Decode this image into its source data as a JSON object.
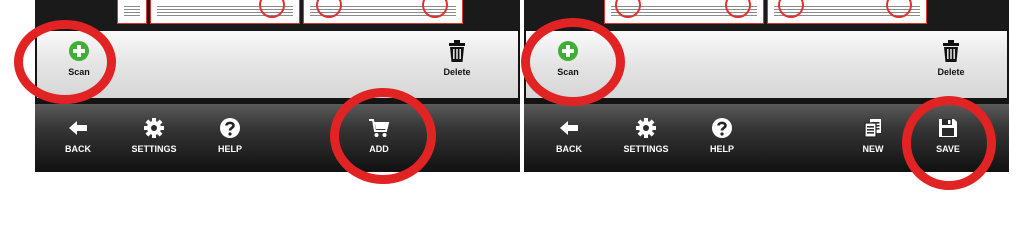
{
  "screens": [
    {
      "top_toolbar": {
        "scan_label": "Scan",
        "delete_label": "Delete"
      },
      "bottom_toolbar": {
        "back_label": "BACK",
        "settings_label": "SETTINGS",
        "help_label": "HELP",
        "add_label": "ADD"
      }
    },
    {
      "top_toolbar": {
        "scan_label": "Scan",
        "delete_label": "Delete"
      },
      "bottom_toolbar": {
        "back_label": "BACK",
        "settings_label": "SETTINGS",
        "help_label": "HELP",
        "new_label": "NEW",
        "save_label": "SAVE"
      }
    }
  ],
  "colors": {
    "highlight_ring": "#e22323",
    "scan_icon_green": "#3fae35",
    "toolbar_dark": "#222222",
    "toolbar_light": "#e6e6e6"
  },
  "icons": [
    "plus-circle-icon",
    "trash-icon",
    "arrow-left-icon",
    "gear-icon",
    "question-icon",
    "cart-icon",
    "copy-pages-icon",
    "floppy-disk-icon"
  ]
}
